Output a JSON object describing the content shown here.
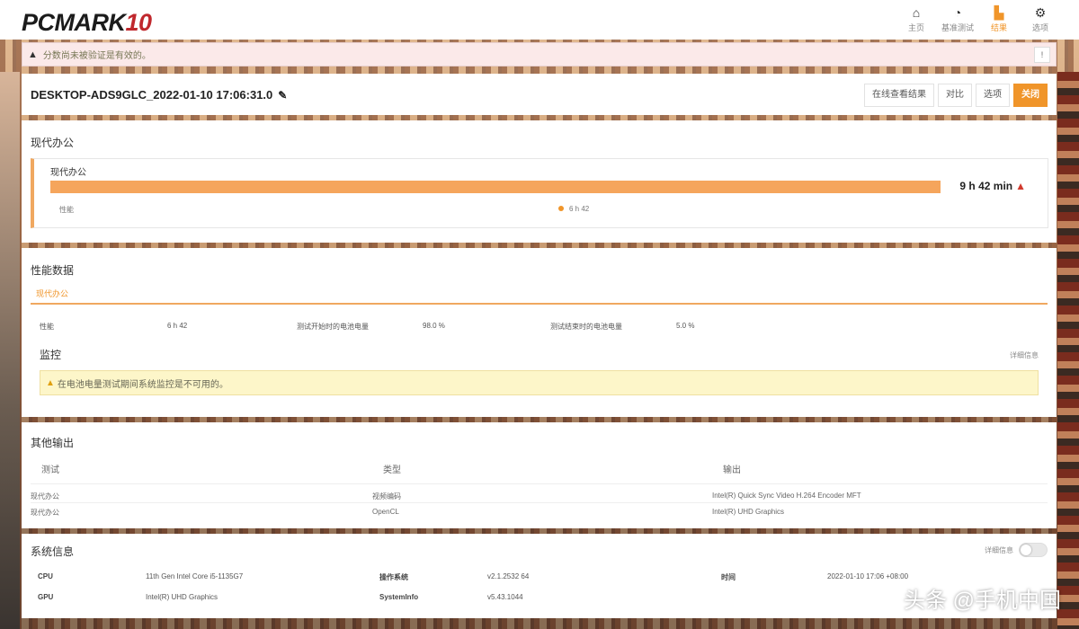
{
  "app": {
    "logo_main": "PCMARK",
    "logo_num": "10"
  },
  "nav": [
    {
      "label": "主页",
      "icon": "home-icon"
    },
    {
      "label": "基准测试",
      "icon": "gauge-icon"
    },
    {
      "label": "结果",
      "icon": "results-chart-icon"
    },
    {
      "label": "选项",
      "icon": "gear-icon"
    }
  ],
  "alert": {
    "text": "分数尚未被验证是有效的。",
    "close": "!"
  },
  "result_header": {
    "title": "DESKTOP-ADS9GLC_2022-01-10 17:06:31.0",
    "buttons": [
      "在线查看结果",
      "对比",
      "选项",
      "关闭"
    ]
  },
  "modern_office": {
    "section_title": "现代办公",
    "card_name": "现代办公",
    "score": "9 h 42 min",
    "sub_label": "性能",
    "legend": "6 h 42",
    "bar_fill": 1.0,
    "colors": {
      "bar": "#f5a55c",
      "accent": "#f0952a"
    }
  },
  "performance": {
    "section_title": "性能数据",
    "tab": "现代办公",
    "rows": [
      {
        "label": "性能",
        "value": "6 h 42"
      },
      {
        "label": "测试开始时的电池电量",
        "value": "98.0 %"
      },
      {
        "label": "测试结束时的电池电量",
        "value": "5.0 %"
      }
    ],
    "monitor_title": "监控",
    "monitor_detail": "详细信息",
    "monitor_warning": "在电池电量测试期间系统监控是不可用的。"
  },
  "other_outputs": {
    "section_title": "其他输出",
    "columns": [
      "测试",
      "类型",
      "输出"
    ],
    "rows": [
      {
        "test": "现代办公",
        "type": "视频编码",
        "output": "Intel(R) Quick Sync Video H.264 Encoder MFT"
      },
      {
        "test": "现代办公",
        "type": "OpenCL",
        "output": "Intel(R) UHD Graphics"
      }
    ]
  },
  "system_info": {
    "section_title": "系统信息",
    "toggle_label": "详细信息",
    "rows": [
      {
        "k1": "CPU",
        "v1": "11th Gen Intel Core i5-1135G7",
        "k2": "操作系统",
        "v2": "v2.1.2532 64",
        "k3": "时间",
        "v3": "2022-01-10 17:06 +08:00"
      },
      {
        "k1": "GPU",
        "v1": "Intel(R) UHD Graphics",
        "k2": "SystemInfo",
        "v2": "v5.43.1044",
        "k3": "",
        "v3": ""
      }
    ]
  },
  "watermark": "头条 @手机中国"
}
